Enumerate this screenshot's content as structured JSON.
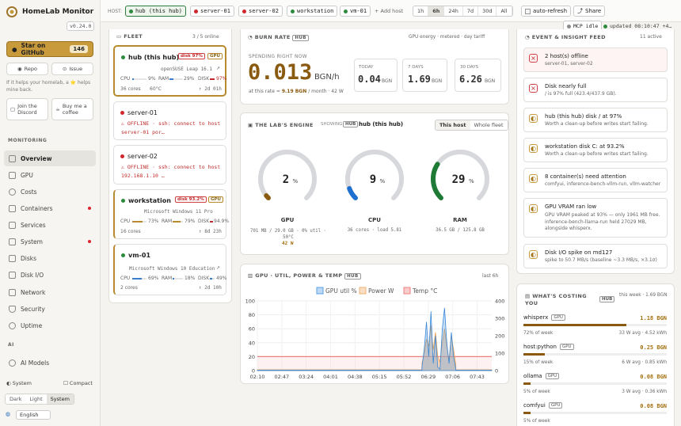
{
  "app": {
    "title": "HomeLab Monitor",
    "version": "v0.24.0"
  },
  "sidebar": {
    "star_label": "Star on GitHub",
    "star_count": "146",
    "repo_label": "Repo",
    "issue_label": "Issue",
    "hint": "If it helps your homelab, a ⭐ helps mine back.",
    "discord_label": "Join the Discord",
    "coffee_label": "Buy me a coffee",
    "monitoring_label": "MONITORING",
    "items": [
      {
        "label": "Overview"
      },
      {
        "label": "GPU"
      },
      {
        "label": "Costs"
      },
      {
        "label": "Containers"
      },
      {
        "label": "Services"
      },
      {
        "label": "System"
      },
      {
        "label": "Disks"
      },
      {
        "label": "Disk I/O"
      },
      {
        "label": "Network"
      },
      {
        "label": "Security"
      },
      {
        "label": "Uptime"
      }
    ],
    "ai_label": "AI",
    "ai_item": "AI Models",
    "system_label": "System",
    "compact_label": "Compact",
    "theme": [
      "Dark",
      "Light",
      "System"
    ],
    "language": "English"
  },
  "topbar": {
    "host_label": "HOST:",
    "hosts": [
      "hub (this hub)",
      "server-01",
      "server-02",
      "workstation",
      "vm-01"
    ],
    "add_host": "+ Add host",
    "ranges": [
      "1h",
      "6h",
      "24h",
      "7d",
      "30d",
      "All"
    ],
    "auto_refresh": "auto-refresh",
    "share": "Share",
    "mcp": "MCP idle",
    "updated": "updated 08:10:47 +4…"
  },
  "fleet": {
    "title": "FLEET",
    "count": "3 / 5 online",
    "hosts": [
      {
        "name": "hub (this hub)",
        "badge": "disk 97%",
        "badge2": "GPU",
        "os": "openSUSE Leap 16.1",
        "cpu": "9%",
        "ram": "29%",
        "disk": "97%",
        "cores": "36 cores",
        "temp": "60°C",
        "uptime": "↑ 2d 01h"
      },
      {
        "name": "server-01",
        "error": "⚠ OFFLINE · ssh: connect to host server-01 por…"
      },
      {
        "name": "server-02",
        "error": "⚠ OFFLINE · ssh: connect to host 192.168.1.10 …"
      },
      {
        "name": "workstation",
        "badge": "disk 93.2%",
        "badge2": "GPU",
        "os": "Microsoft Windows 11 Pro",
        "cpu": "73%",
        "ram": "79%",
        "disk": "94.9%",
        "cores": "16 cores",
        "uptime": "↑ 8d 23h"
      },
      {
        "name": "vm-01",
        "os": "Microsoft Windows 10 Education",
        "cpu": "69%",
        "ram": "18%",
        "disk": "49%",
        "cores": "2 cores",
        "uptime": "↑ 2d 10h"
      }
    ],
    "cpu_label": "CPU",
    "ram_label": "RAM",
    "disk_label": "DISK"
  },
  "burn": {
    "title": "BURN RATE",
    "hub": "HUB",
    "meta": "GPU energy · metered · day tariff",
    "spending_label": "SPENDING RIGHT NOW",
    "value": "0.013",
    "unit": "BGN/h",
    "rate_prefix": "at this rate ≈",
    "rate_value": "9.19 BGN",
    "rate_suffix": "/ month · 42 W",
    "boxes": [
      {
        "label": "TODAY",
        "value": "0.04",
        "unit": "BGN"
      },
      {
        "label": "7 DAYS",
        "value": "1.69",
        "unit": "BGN"
      },
      {
        "label": "30 DAYS",
        "value": "6.26",
        "unit": "BGN"
      }
    ]
  },
  "engine": {
    "title": "THE LAB'S ENGINE",
    "showing": "SHOWING",
    "hub": "HUB",
    "host": "hub (this hub)",
    "toggle": [
      "This host",
      "Whole fleet"
    ],
    "gauges": [
      {
        "value": "2",
        "unit": "%",
        "label": "GPU",
        "sub": "701 MB / 29.0 GB · 0% util · 50°C",
        "sub2": "42 W",
        "pct": 2,
        "color": "#8a5a10"
      },
      {
        "value": "9",
        "unit": "%",
        "label": "CPU",
        "sub": "36 cores · load 5.81",
        "pct": 9,
        "color": "#1f6fd0"
      },
      {
        "value": "29",
        "unit": "%",
        "label": "RAM",
        "sub": "36.5 GB / 125.8 GB",
        "pct": 29,
        "color": "#1e7a35"
      }
    ]
  },
  "gpu_chart": {
    "title": "GPU · UTIL, POWER & TEMP",
    "hub": "HUB",
    "range": "last 6h"
  },
  "chart_data": {
    "type": "line",
    "title": "",
    "x": [
      "02:10",
      "02:47",
      "03:24",
      "04:01",
      "04:38",
      "05:15",
      "05:52",
      "06:29",
      "07:06",
      "07:43"
    ],
    "series": [
      {
        "name": "GPU util %",
        "color": "#5aa0e6"
      },
      {
        "name": "Power W",
        "color": "#f0b070"
      },
      {
        "name": "Temp °C",
        "color": "#f08080"
      }
    ],
    "ylim_left": [
      0,
      100
    ],
    "ylim_right": [
      0,
      400
    ],
    "yticks_left": [
      0,
      20,
      40,
      60,
      80,
      100
    ],
    "yticks_right": [
      0,
      100,
      200,
      300,
      400
    ],
    "temp_level": 20
  },
  "feed": {
    "title": "EVENT & INSIGHT FEED",
    "count": "11 active",
    "items": [
      {
        "title": "2 host(s) offline",
        "sub": "server-01, server-02"
      },
      {
        "title": "Disk nearly full",
        "sub": "/ is 97% full (423.4/437.9 GB)."
      },
      {
        "title": "hub (this hub) disk / at 97%",
        "sub": "Worth a clean-up before writes start failing."
      },
      {
        "title": "workstation disk C: at 93.2%",
        "sub": "Worth a clean-up before writes start failing."
      },
      {
        "title": "8 container(s) need attention",
        "sub": "comfyui, inference-bench-vllm-run, vllm-watcher"
      },
      {
        "title": "GPU VRAM ran low",
        "sub": "GPU VRAM peaked at 93% — only 1961 MB free. inference-bench-llama-run held 27029 MB, alongside whisperx."
      },
      {
        "title": "Disk I/O spike on md127",
        "sub": "spike to 50.7 MB/s (baseline ~3.3 MB/s, ×3.1σ)"
      }
    ]
  },
  "costing": {
    "title": "WHAT'S COSTING YOU",
    "hub": "HUB",
    "meta": "this week · 1.69 BGN",
    "items": [
      {
        "name": "whisperx",
        "tag": "GPU",
        "value": "1.18 BGN",
        "pct": 72,
        "left": "72% of week",
        "right": "33 W avg · 4.52 kWh"
      },
      {
        "name": "host:python",
        "tag": "GPU",
        "value": "0.25 BGN",
        "pct": 15,
        "left": "15% of week",
        "right": "6 W avg · 0.85 kWh"
      },
      {
        "name": "ollama",
        "tag": "GPU",
        "value": "0.08 BGN",
        "pct": 5,
        "left": "5% of week",
        "right": "3 W avg · 0.36 kWh"
      },
      {
        "name": "comfyui",
        "tag": "GPU",
        "value": "0.08 BGN",
        "pct": 5,
        "left": "5% of week",
        "right": ""
      }
    ]
  }
}
